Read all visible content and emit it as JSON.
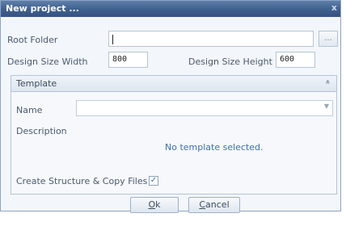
{
  "window": {
    "title": "New project ...",
    "close_glyph": "x"
  },
  "form": {
    "root_folder_label": "Root Folder",
    "root_folder_value": "",
    "browse_label": "...",
    "width_label": "Design Size Width",
    "width_value": "800",
    "height_label": "Design Size Height",
    "height_value": "600"
  },
  "template": {
    "section_title": "Template",
    "collapse_glyph": "«",
    "name_label": "Name",
    "name_value": "",
    "description_label": "Description",
    "description_text": "No template selected.",
    "create_structure_label": "Create Structure & Copy Files",
    "create_structure_checked": true
  },
  "buttons": {
    "ok_mnemonic": "O",
    "ok_rest": "k",
    "cancel_mnemonic": "C",
    "cancel_rest": "ancel"
  },
  "icons": {
    "collapse": "double-chevron-up-icon",
    "dropdown": "chevron-down-icon",
    "check": "checkmark-icon"
  }
}
